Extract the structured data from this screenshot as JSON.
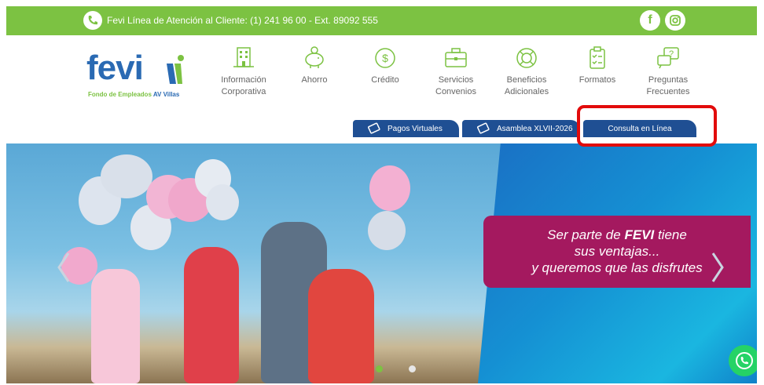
{
  "topbar": {
    "contact_text": "Fevi Línea de Atención al Cliente: (1) 241 96 00 - Ext. 89092 555",
    "social": [
      "f",
      "instagram"
    ]
  },
  "logo": {
    "wordmark": "fevi",
    "tagline_part1": "Fondo de Empleados ",
    "tagline_part2": "AV Villas"
  },
  "nav": [
    {
      "icon": "building-icon",
      "label_line1": "Información",
      "label_line2": "Corporativa"
    },
    {
      "icon": "piggy-bank-icon",
      "label_line1": "Ahorro",
      "label_line2": ""
    },
    {
      "icon": "dollar-coin-icon",
      "label_line1": "Crédito",
      "label_line2": ""
    },
    {
      "icon": "briefcase-icon",
      "label_line1": "Servicios",
      "label_line2": "Convenios"
    },
    {
      "icon": "lifebuoy-icon",
      "label_line1": "Beneficios",
      "label_line2": "Adicionales"
    },
    {
      "icon": "clipboard-icon",
      "label_line1": "Formatos",
      "label_line2": ""
    },
    {
      "icon": "chat-question-icon",
      "label_line1": "Preguntas",
      "label_line2": "Frecuentes"
    }
  ],
  "tabs": [
    {
      "icon": "card-icon",
      "label": "Pagos Virtuales"
    },
    {
      "icon": "card-icon",
      "label": "Asamblea XLVII-2026"
    },
    {
      "icon": "",
      "label": "Consulta en Línea"
    }
  ],
  "hero": {
    "line1_prefix": "Ser parte de ",
    "line1_brand": "FEVI",
    "line1_suffix": " tiene",
    "line2": "sus ventajas...",
    "line3": "y queremos que las disfrutes"
  },
  "colors": {
    "green": "#7cc242",
    "blue": "#1f4f93",
    "magenta": "#a4195f",
    "highlight_red": "#e20b0b"
  }
}
